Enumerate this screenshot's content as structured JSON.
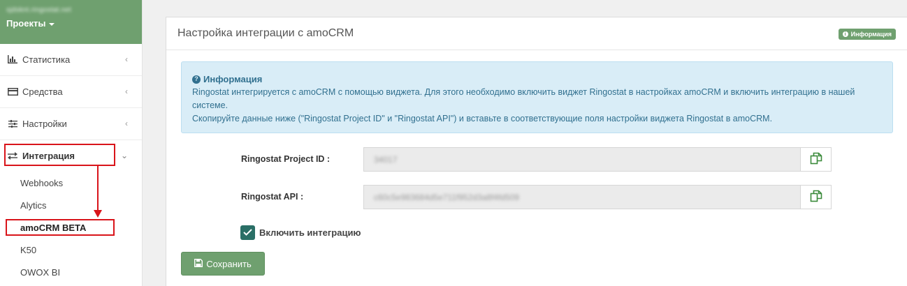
{
  "sidebar": {
    "host": "sjdsknt.ringostat.net",
    "projects_label": "Проекты",
    "items": [
      {
        "label": "Статистика",
        "chevron": "‹"
      },
      {
        "label": "Средства",
        "chevron": "‹"
      },
      {
        "label": "Настройки",
        "chevron": "‹"
      },
      {
        "label": "Интеграция",
        "chevron": "⌄"
      }
    ],
    "subitems": [
      "Webhooks",
      "Alytics",
      "amoCRM BETA",
      "K50",
      "OWOX BI"
    ]
  },
  "panel": {
    "title": "Настройка интеграции с amoCRM",
    "badge": "Информация"
  },
  "alert": {
    "title": "Информация",
    "line1": "Ringostat интегрируется с amoCRM с помощью виджета. Для этого необходимо включить виджет Ringostat в настройках amoCRM и включить интеграцию в нашей",
    "line2": "системе.",
    "line3": "Скопируйте данные ниже (\"Ringostat Project ID\" и \"Ringostat API\") и вставьте в соответствующие поля настройки виджета Ringostat в amoCRM."
  },
  "form": {
    "project_id_label": "Ringostat Project ID :",
    "project_id_value": "34017",
    "api_label": "Ringostat API :",
    "api_value": "c60c5e983684d5e711f952d3a8f4fd509",
    "checkbox_label": "Включить интеграцию",
    "checkbox_checked": true,
    "save_label": "Сохранить"
  },
  "colors": {
    "accent_green": "#6fa06f",
    "highlight_red": "#d9141a",
    "info_blue": "#d9edf7"
  }
}
